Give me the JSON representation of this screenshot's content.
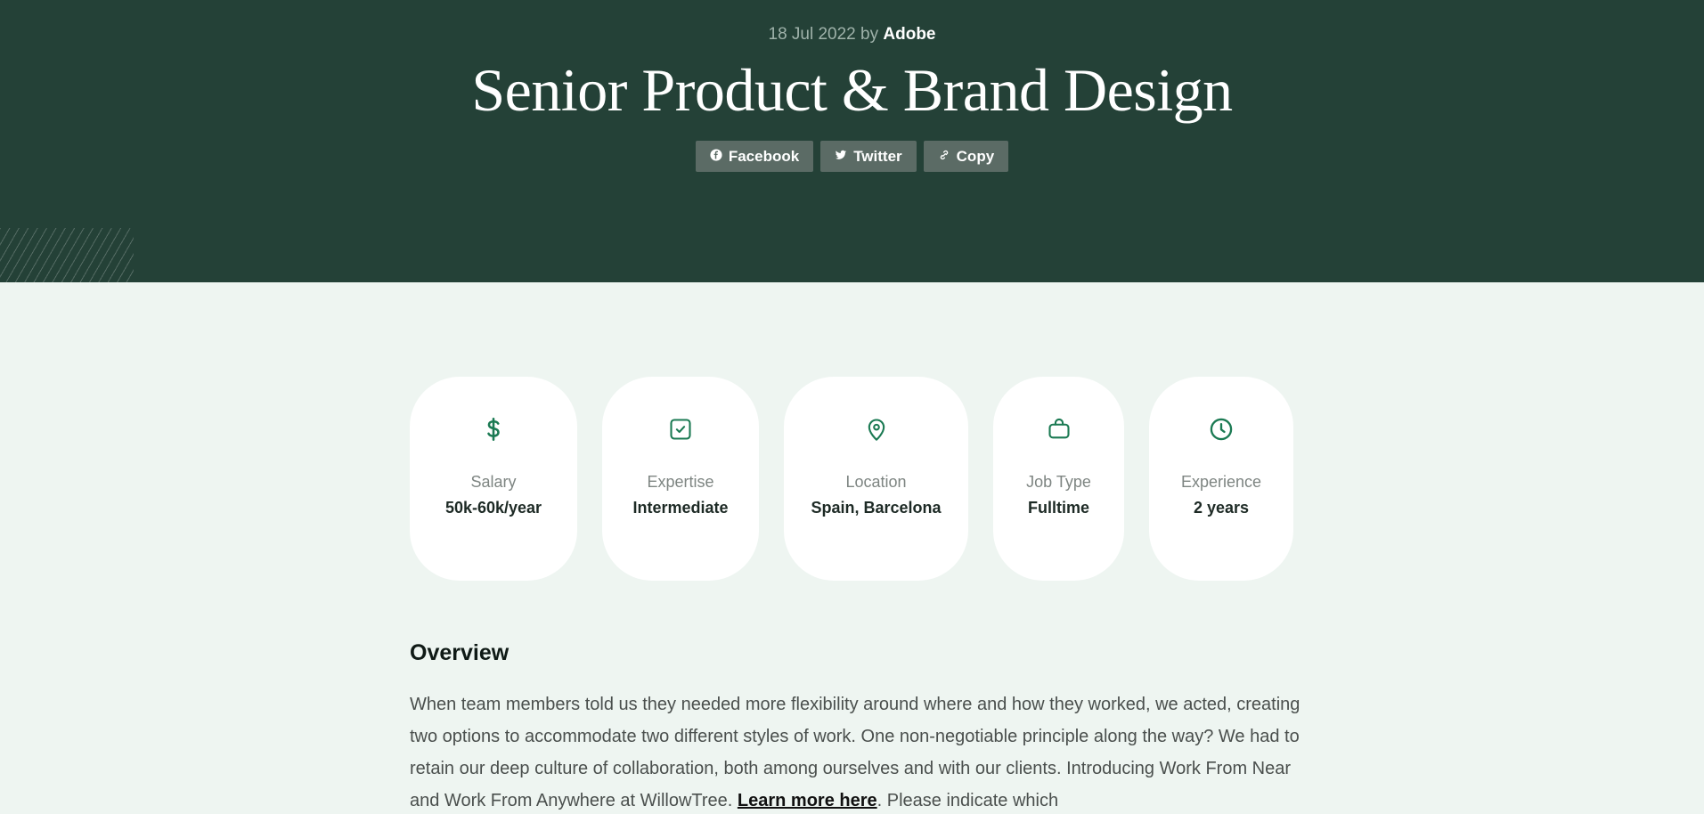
{
  "header": {
    "date": "18 Jul 2022",
    "by": "by",
    "author": "Adobe",
    "title": "Senior Product & Brand Design"
  },
  "share": {
    "facebook": "Facebook",
    "twitter": "Twitter",
    "copy": "Copy"
  },
  "details": [
    {
      "icon": "dollar-icon",
      "label": "Salary",
      "value": "50k-60k/year"
    },
    {
      "icon": "checkbox-icon",
      "label": "Expertise",
      "value": "Intermediate"
    },
    {
      "icon": "map-pin-icon",
      "label": "Location",
      "value": "Spain, Barcelona"
    },
    {
      "icon": "briefcase-icon",
      "label": "Job Type",
      "value": "Fulltime"
    },
    {
      "icon": "clock-icon",
      "label": "Experience",
      "value": "2 years"
    }
  ],
  "overview": {
    "title": "Overview",
    "text_before_link": "When team members told us they needed more flexibility around where and how they worked, we acted, creating two options to accommodate two different styles of work. One non-negotiable principle along the way? We had to retain our deep culture of collaboration, both among ourselves and with our clients. Introducing Work From Near and Work From Anywhere at WillowTree. ",
    "link_text": "Learn more here",
    "text_after_link": ". Please indicate which"
  },
  "colors": {
    "hero_bg": "#244137",
    "page_bg": "#eef5f1",
    "accent_green": "#1b7a53",
    "share_button_bg": "#5b6b65"
  }
}
